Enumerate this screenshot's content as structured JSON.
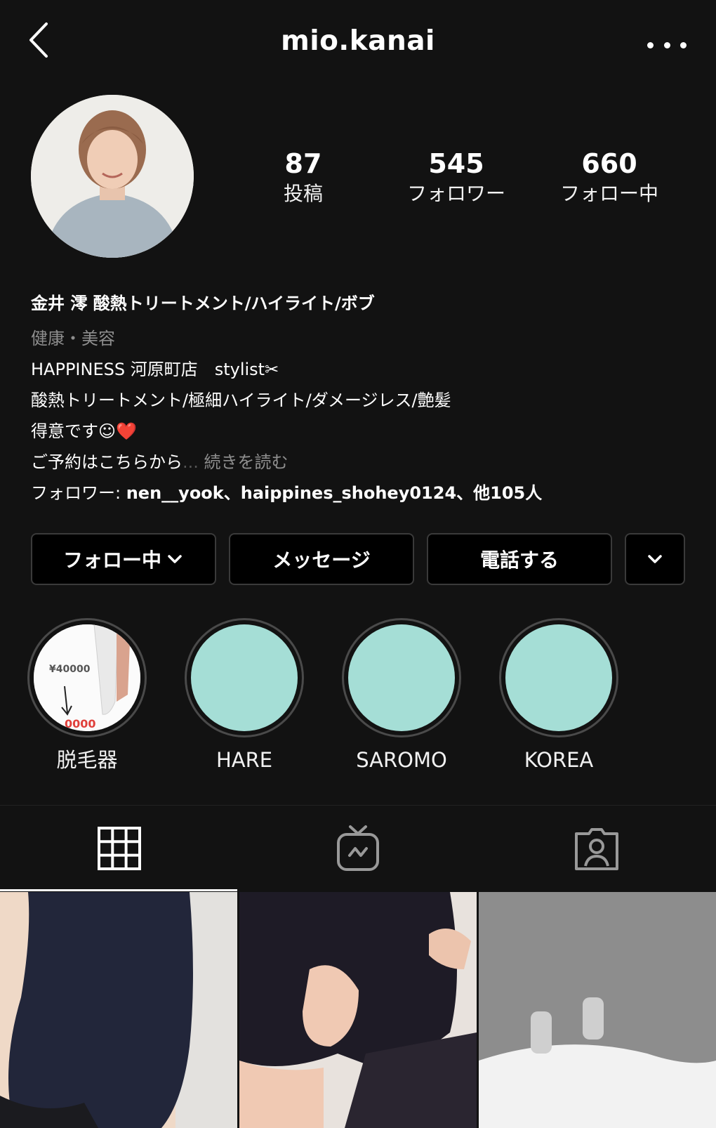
{
  "header": {
    "username": "mio.kanai",
    "back_icon": "chevron-left-icon",
    "more_icon": "more-horizontal-icon"
  },
  "stats": {
    "posts": {
      "value": "87",
      "label": "投稿"
    },
    "followers": {
      "value": "545",
      "label": "フォロワー"
    },
    "following": {
      "value": "660",
      "label": "フォロー中"
    }
  },
  "bio": {
    "name": "金井 澪  酸熱トリートメント/ハイライト/ボブ",
    "category": "健康・美容",
    "line1": "HAPPINESS 河原町店　stylist✂︎",
    "line2": "酸熱トリートメント/極細ハイライト/ダメージレス/艶髪",
    "line3": "得意です☺︎",
    "line3_emoji": "❤️",
    "line4": "ご予約はこちらから",
    "ellipsis": "...",
    "read_more": " 続きを読む",
    "followed_by_prefix": "フォロワー: ",
    "followed_by_names": "nen__yook、haippines_shohey0124、他105人"
  },
  "actions": {
    "following_label": "フォロー中",
    "message_label": "メッセージ",
    "call_label": "電話する"
  },
  "highlights": [
    {
      "label": "脱毛器",
      "cover_text": "¥40000",
      "cover_text2": "0000"
    },
    {
      "label": "HARE"
    },
    {
      "label": "SAROMO"
    },
    {
      "label": "KOREA"
    }
  ],
  "tabs": [
    "grid-icon",
    "igtv-icon",
    "tagged-icon"
  ],
  "colors": {
    "background": "#121212",
    "highlight_fill": "#a5ded6",
    "muted_text": "#8e8e8e"
  }
}
